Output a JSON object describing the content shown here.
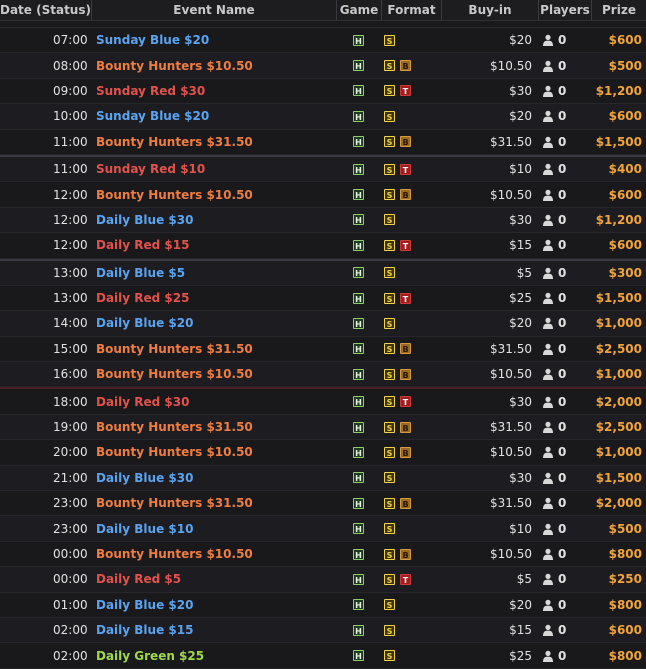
{
  "header": {
    "date_status": "Date (Status)",
    "event_name": "Event Name",
    "game": "Game",
    "format": "Format",
    "buy_in": "Buy-in",
    "players": "Players",
    "prize": "Prize"
  },
  "icons": {
    "game": "H",
    "format_standard": "S",
    "format_bounty": "B",
    "format_turbo": "T",
    "players": "person-icon"
  },
  "colors": {
    "blue": "#5ca3ef",
    "red": "#e2524c",
    "orange": "#ee7d42",
    "green": "#9fd84a",
    "prize": "#f2a43c"
  },
  "rows": [
    {
      "time": "07:00",
      "name": "Sunday Blue $20",
      "color": "blue",
      "bounty": false,
      "turbo": false,
      "buyin": "$20",
      "players": "0",
      "prize": "$600"
    },
    {
      "time": "08:00",
      "name": "Bounty Hunters $10.50",
      "color": "orange",
      "bounty": true,
      "turbo": false,
      "buyin": "$10.50",
      "players": "0",
      "prize": "$500"
    },
    {
      "time": "09:00",
      "name": "Sunday Red $30",
      "color": "red",
      "bounty": false,
      "turbo": true,
      "buyin": "$30",
      "players": "0",
      "prize": "$1,200"
    },
    {
      "time": "10:00",
      "name": "Sunday Blue $20",
      "color": "blue",
      "bounty": false,
      "turbo": false,
      "buyin": "$20",
      "players": "0",
      "prize": "$600"
    },
    {
      "time": "11:00",
      "name": "Bounty Hunters $31.50",
      "color": "orange",
      "bounty": true,
      "turbo": false,
      "buyin": "$31.50",
      "players": "0",
      "prize": "$1,500"
    },
    {
      "time": "11:00",
      "name": "Sunday Red $10",
      "color": "red",
      "bounty": false,
      "turbo": true,
      "buyin": "$10",
      "players": "0",
      "prize": "$400"
    },
    {
      "time": "12:00",
      "name": "Bounty Hunters $10.50",
      "color": "orange",
      "bounty": true,
      "turbo": false,
      "buyin": "$10.50",
      "players": "0",
      "prize": "$600"
    },
    {
      "time": "12:00",
      "name": "Daily Blue $30",
      "color": "blue",
      "bounty": false,
      "turbo": false,
      "buyin": "$30",
      "players": "0",
      "prize": "$1,200"
    },
    {
      "time": "12:00",
      "name": "Daily Red $15",
      "color": "red",
      "bounty": false,
      "turbo": true,
      "buyin": "$15",
      "players": "0",
      "prize": "$600"
    },
    {
      "time": "13:00",
      "name": "Daily Blue $5",
      "color": "blue",
      "bounty": false,
      "turbo": false,
      "buyin": "$5",
      "players": "0",
      "prize": "$300"
    },
    {
      "time": "13:00",
      "name": "Daily Red $25",
      "color": "red",
      "bounty": false,
      "turbo": true,
      "buyin": "$25",
      "players": "0",
      "prize": "$1,500"
    },
    {
      "time": "14:00",
      "name": "Daily Blue $20",
      "color": "blue",
      "bounty": false,
      "turbo": false,
      "buyin": "$20",
      "players": "0",
      "prize": "$1,000"
    },
    {
      "time": "15:00",
      "name": "Bounty Hunters $31.50",
      "color": "orange",
      "bounty": true,
      "turbo": false,
      "buyin": "$31.50",
      "players": "0",
      "prize": "$2,500"
    },
    {
      "time": "16:00",
      "name": "Bounty Hunters $10.50",
      "color": "orange",
      "bounty": true,
      "turbo": false,
      "buyin": "$10.50",
      "players": "0",
      "prize": "$1,000"
    },
    {
      "time": "18:00",
      "name": "Daily Red $30",
      "color": "red",
      "bounty": false,
      "turbo": true,
      "buyin": "$30",
      "players": "0",
      "prize": "$2,000"
    },
    {
      "time": "19:00",
      "name": "Bounty Hunters $31.50",
      "color": "orange",
      "bounty": true,
      "turbo": false,
      "buyin": "$31.50",
      "players": "0",
      "prize": "$2,500"
    },
    {
      "time": "20:00",
      "name": "Bounty Hunters $10.50",
      "color": "orange",
      "bounty": true,
      "turbo": false,
      "buyin": "$10.50",
      "players": "0",
      "prize": "$1,000"
    },
    {
      "time": "21:00",
      "name": "Daily Blue $30",
      "color": "blue",
      "bounty": false,
      "turbo": false,
      "buyin": "$30",
      "players": "0",
      "prize": "$1,500"
    },
    {
      "time": "23:00",
      "name": "Bounty Hunters $31.50",
      "color": "orange",
      "bounty": true,
      "turbo": false,
      "buyin": "$31.50",
      "players": "0",
      "prize": "$2,000"
    },
    {
      "time": "23:00",
      "name": "Daily Blue $10",
      "color": "blue",
      "bounty": false,
      "turbo": false,
      "buyin": "$10",
      "players": "0",
      "prize": "$500"
    },
    {
      "time": "00:00",
      "name": "Bounty Hunters $10.50",
      "color": "orange",
      "bounty": true,
      "turbo": false,
      "buyin": "$10.50",
      "players": "0",
      "prize": "$800"
    },
    {
      "time": "00:00",
      "name": "Daily Red $5",
      "color": "red",
      "bounty": false,
      "turbo": true,
      "buyin": "$5",
      "players": "0",
      "prize": "$250"
    },
    {
      "time": "01:00",
      "name": "Daily Blue $20",
      "color": "blue",
      "bounty": false,
      "turbo": false,
      "buyin": "$20",
      "players": "0",
      "prize": "$800"
    },
    {
      "time": "02:00",
      "name": "Daily Blue $15",
      "color": "blue",
      "bounty": false,
      "turbo": false,
      "buyin": "$15",
      "players": "0",
      "prize": "$600"
    },
    {
      "time": "02:00",
      "name": "Daily Green $25",
      "color": "green",
      "bounty": false,
      "turbo": false,
      "buyin": "$25",
      "players": "0",
      "prize": "$800"
    }
  ]
}
